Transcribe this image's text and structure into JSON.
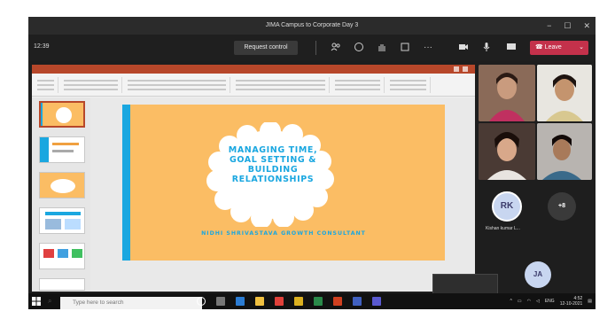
{
  "window": {
    "title": "JIMA Campus to Corporate Day 3",
    "minimize": "−",
    "maximize": "☐",
    "close": "✕"
  },
  "toolbar": {
    "timer": "12:39",
    "request_control": "Request control",
    "leave": "Leave",
    "more": "···"
  },
  "slide": {
    "title_lines": [
      "MANAGING TIME,",
      "GOAL SETTING &",
      "BUILDING",
      "RELATIONSHIPS"
    ],
    "subtitle": "NIDHI SHRIVASTAVA GROWTH CONSULTANT"
  },
  "participants": {
    "rk_initials": "RK",
    "rk_name": "Kishan kumar L...",
    "plus_more": "+8",
    "ja_initials": "JA"
  },
  "taskbar": {
    "search_placeholder": "Type here to search",
    "lang": "ENG",
    "time": "4:52",
    "date": "12-10-2021"
  },
  "colors": {
    "leave": "#c4314b",
    "slide_bg": "#fbbd64",
    "slide_accent": "#1aa7e0",
    "ppt_red": "#b7472a"
  }
}
